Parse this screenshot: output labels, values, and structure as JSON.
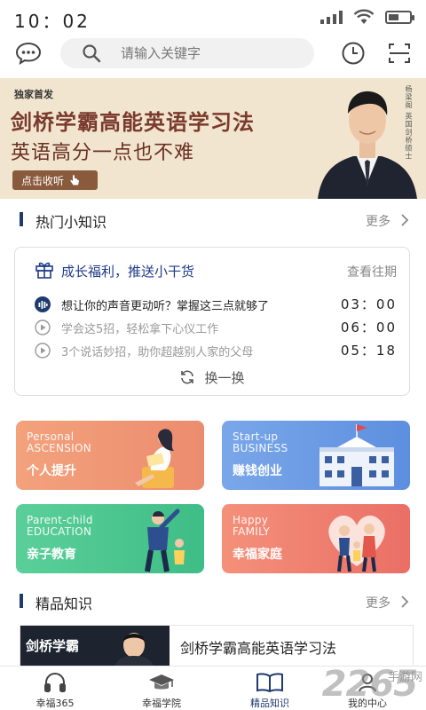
{
  "status": {
    "time": "10：02",
    "battery_level": 0.5
  },
  "search": {
    "placeholder": "请输入关键字"
  },
  "banner": {
    "tag": "独家首发",
    "title": "剑桥学霸高能英语学习法",
    "subtitle": "英语高分一点也不难",
    "button": "点击收听",
    "vertical_caption": "杨梁阁 英国剑桥硕士"
  },
  "hot_section": {
    "title": "热门小知识",
    "more": "更多"
  },
  "knowledge_card": {
    "title": "成长福利，推送小干货",
    "history": "查看往期",
    "items": [
      {
        "text": "想让你的声音更动听？掌握这三点就够了",
        "duration": "03：00",
        "playing": true
      },
      {
        "text": "学会这5招，轻松拿下心仪工作",
        "duration": "06：00",
        "playing": false
      },
      {
        "text": "3个说话妙招，助你超越别人家的父母",
        "duration": "05：18",
        "playing": false
      }
    ],
    "refresh": "换一换"
  },
  "tiles": [
    {
      "en1": "Personal",
      "en2": "ASCENSION",
      "zh": "个人提升",
      "color_from": "#f3a27c",
      "color_to": "#ec8c6f"
    },
    {
      "en1": "Start-up",
      "en2": "BUSINESS",
      "zh": "赚钱创业",
      "color_from": "#7aa7e9",
      "color_to": "#5d8fdf"
    },
    {
      "en1": "Parent-child",
      "en2": "EDUCATION",
      "zh": "亲子教育",
      "color_from": "#5bcf9a",
      "color_to": "#3fbd86"
    },
    {
      "en1": "Happy",
      "en2": "FAMILY",
      "zh": "幸福家庭",
      "color_from": "#f4907a",
      "color_to": "#ea6f66"
    }
  ],
  "premium_section": {
    "title": "精品知识",
    "more": "更多"
  },
  "premium_item": {
    "thumb_text": "剑桥学霸",
    "title": "剑桥学霸高能英语学习法"
  },
  "tab_bar": [
    {
      "label": "幸福365",
      "icon": "headphones-icon"
    },
    {
      "label": "幸福学院",
      "icon": "graduation-cap-icon"
    },
    {
      "label": "精品知识",
      "icon": "open-book-icon",
      "active": true
    },
    {
      "label": "我的中心",
      "icon": "user-icon"
    }
  ],
  "watermark": {
    "brand": "2265",
    "sub": "手游网"
  },
  "colors": {
    "accent": "#1e3a6e",
    "link": "#1e3a8a",
    "banner_bg": "#f2e5cf"
  }
}
